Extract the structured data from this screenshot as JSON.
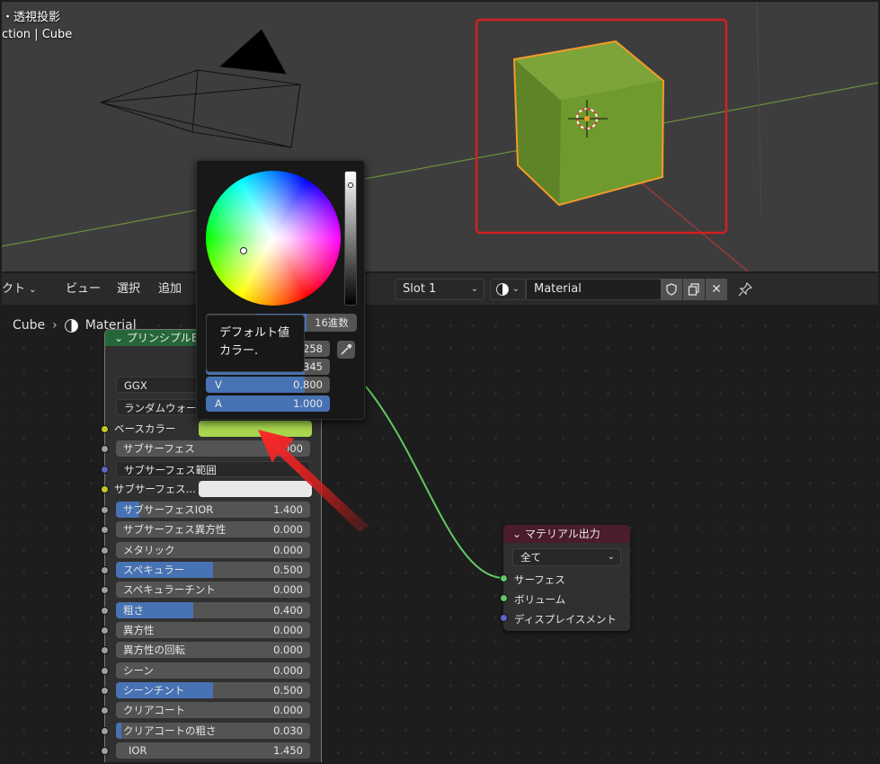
{
  "viewport": {
    "mode_text": "・透視投影",
    "collection_text": "ction | Cube"
  },
  "header": {
    "menu_partial": "クト",
    "view": "ビュー",
    "select": "選択",
    "add": "追加",
    "slot": "Slot 1",
    "material_name": "Material"
  },
  "breadcrumb": {
    "object": "Cube",
    "material": "Material"
  },
  "bsdf": {
    "title": "プリンシプルBSDF",
    "distribution": "GGX",
    "subsurface_method": "ランダムウォーク",
    "base_color_label": "ベースカラー",
    "base_color": "#a9d64f",
    "subsurface": {
      "label": "サブサーフェス",
      "value": "0.000"
    },
    "subsurface_radius": {
      "label": "サブサーフェス範囲"
    },
    "subsurface_color": {
      "label": "サブサーフェス...",
      "color": "#e8e8e8"
    },
    "sliders": [
      {
        "label": "サブサーフェスIOR",
        "value": "1.400",
        "fill": 0.12
      },
      {
        "label": "サブサーフェス異方性",
        "value": "0.000",
        "fill": 0
      },
      {
        "label": "メタリック",
        "value": "0.000",
        "fill": 0
      },
      {
        "label": "スペキュラー",
        "value": "0.500",
        "fill": 0.5
      },
      {
        "label": "スペキュラーチント",
        "value": "0.000",
        "fill": 0
      },
      {
        "label": "粗さ",
        "value": "0.400",
        "fill": 0.4
      },
      {
        "label": "異方性",
        "value": "0.000",
        "fill": 0
      },
      {
        "label": "異方性の回転",
        "value": "0.000",
        "fill": 0
      },
      {
        "label": "シーン",
        "value": "0.000",
        "fill": 0
      },
      {
        "label": "シーンチント",
        "value": "0.500",
        "fill": 0.5
      },
      {
        "label": "クリアコート",
        "value": "0.000",
        "fill": 0
      },
      {
        "label": "クリアコートの粗さ",
        "value": "0.030",
        "fill": 0.03
      },
      {
        "label": "IOR",
        "value": "1.450",
        "fill": 0
      }
    ]
  },
  "output_node": {
    "title": "マテリアル出力",
    "target": "全て",
    "sockets": [
      "サーフェス",
      "ボリューム",
      "ディスプレイスメント"
    ]
  },
  "color_picker": {
    "tab_hex": "16進数",
    "partial_value_1": "258",
    "partial_value_2": "345",
    "v_label": "V",
    "v_value": "0.800",
    "v_fill": 0.8,
    "a_label": "A",
    "a_value": "1.000",
    "a_fill": 1.0
  },
  "tooltip": {
    "line1": "デフォルト値",
    "line2": "カラー."
  },
  "colors": {
    "accent": "#4772b3",
    "cube": "#6f9a2e",
    "selection": "#f39a2a",
    "annotation_red": "#d42020"
  }
}
